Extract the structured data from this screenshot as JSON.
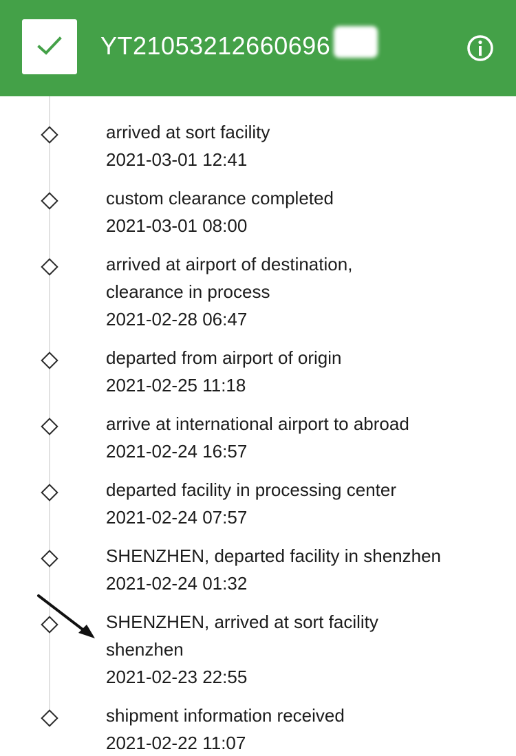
{
  "header": {
    "tracking_number": "YT21053212660696",
    "status_icon": "check-icon",
    "info_icon": "info-icon",
    "accent_color": "#44a148"
  },
  "events": [
    {
      "lines": [
        "arrived at sort facility"
      ],
      "time": "2021-03-01 12:41"
    },
    {
      "lines": [
        "custom clearance completed"
      ],
      "time": "2021-03-01 08:00"
    },
    {
      "lines": [
        "arrived at airport of destination,",
        "clearance in process"
      ],
      "time": "2021-02-28 06:47"
    },
    {
      "lines": [
        "departed from airport of origin"
      ],
      "time": "2021-02-25 11:18"
    },
    {
      "lines": [
        "arrive at international airport to abroad"
      ],
      "time": "2021-02-24 16:57"
    },
    {
      "lines": [
        "departed facility in processing center"
      ],
      "time": "2021-02-24 07:57"
    },
    {
      "lines": [
        "SHENZHEN, departed facility in shenzhen"
      ],
      "time": "2021-02-24 01:32"
    },
    {
      "lines": [
        "SHENZHEN, arrived at sort facility",
        "shenzhen"
      ],
      "time": "2021-02-23 22:55"
    },
    {
      "lines": [
        "shipment information received"
      ],
      "time": "2021-02-22 11:07"
    }
  ]
}
